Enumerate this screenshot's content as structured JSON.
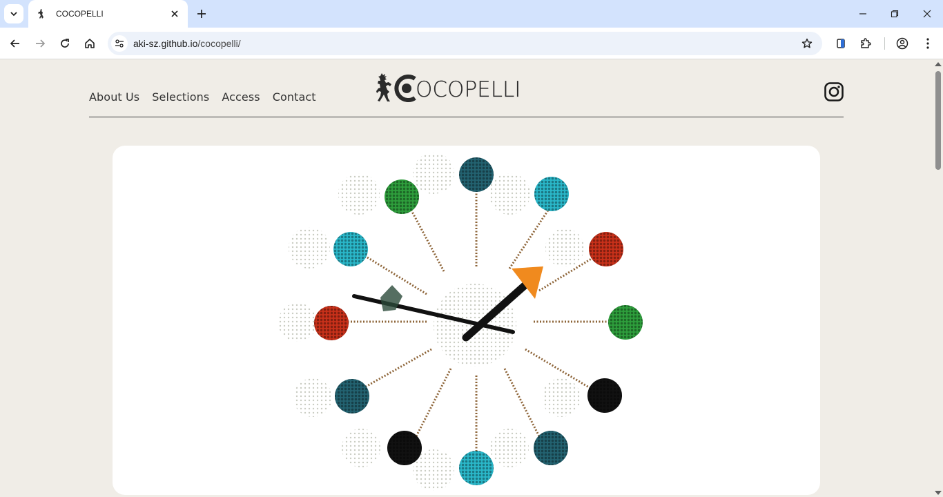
{
  "browser": {
    "tab_title": "COCOPELLI",
    "url_host": "aki-sz.github.io",
    "url_path": "/cocopelli/"
  },
  "site": {
    "logo_text": "OCOPELLI",
    "nav": [
      {
        "label": "About Us"
      },
      {
        "label": "Selections"
      },
      {
        "label": "Access"
      },
      {
        "label": "Contact"
      }
    ]
  },
  "colors": {
    "page_bg": "#f0ede7",
    "card_bg": "#ffffff",
    "text": "#333333",
    "ball_green": "#2e9e3c",
    "ball_cyan": "#2ab7c9",
    "ball_red": "#c8311a",
    "ball_black": "#111111",
    "ball_teal": "#236270",
    "hand_accent": "#f08a1e"
  }
}
